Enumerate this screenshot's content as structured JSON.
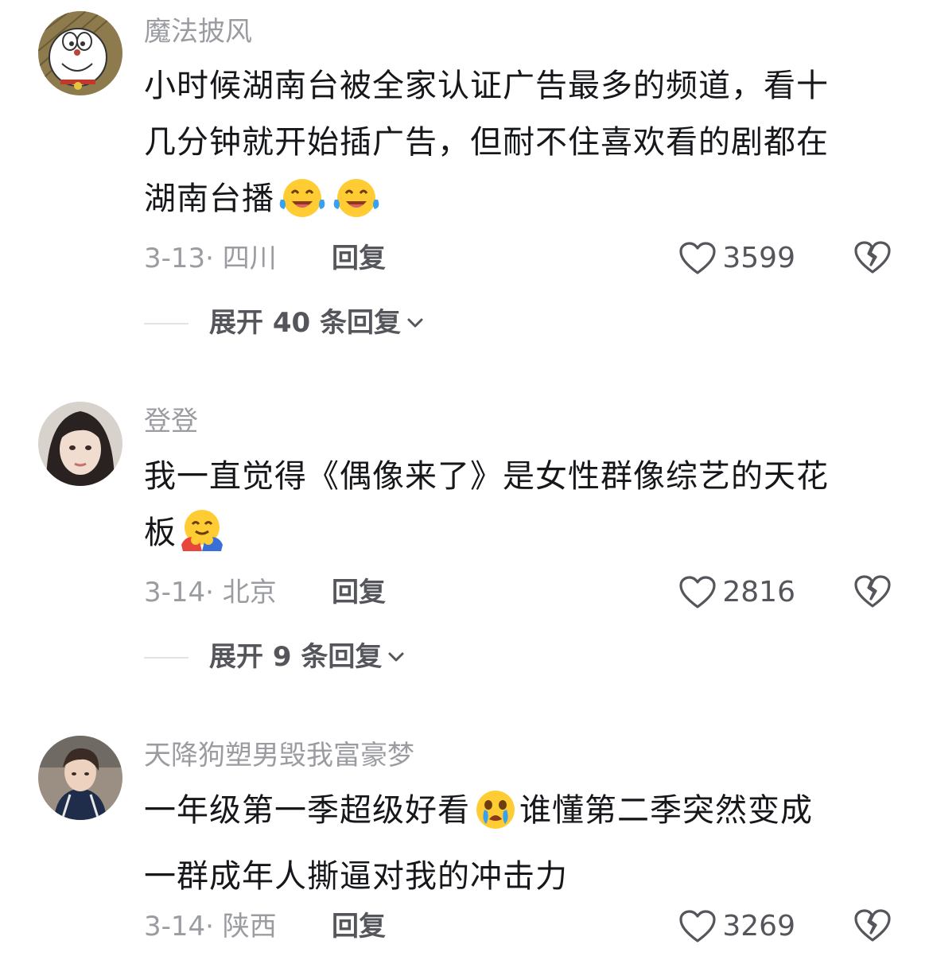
{
  "comments": [
    {
      "username": "魔法披风",
      "avatar_icon": "doraemon-avatar",
      "content_lines": [
        "小时候湖南台被全家认证广告最多的频道，看十",
        "几分钟就开始插广告，但耐不住喜欢看的剧都在",
        "湖南台播"
      ],
      "emojis": [
        "laughing-tears-emoji",
        "laughing-tears-emoji"
      ],
      "date_location": "3-13· 四川",
      "reply_label": "回复",
      "like_count": "3599",
      "expand_label": "展开 40 条回复"
    },
    {
      "username": "登登",
      "avatar_icon": "girl-photo-avatar",
      "content_lines": [
        "我一直觉得《偶像来了》是女性群像综艺的天花",
        "板"
      ],
      "emojis": [
        "hugging-face-emoji"
      ],
      "date_location": "3-14· 北京",
      "reply_label": "回复",
      "like_count": "2816",
      "expand_label": "展开 9 条回复"
    },
    {
      "username": "天降狗塑男毁我富豪梦",
      "avatar_icon": "boy-photo-avatar",
      "content_line1_before_emoji": "一年级第一季超级好看",
      "content_line1_after_emoji": "谁懂第二季突然变成",
      "content_line2": "一群成年人撕逼对我的冲击力",
      "emojis": [
        "crying-face-emoji"
      ],
      "date_location": "3-14· 陕西",
      "reply_label": "回复",
      "like_count": "3269"
    }
  ],
  "icons": {
    "like": "heart-outline-icon",
    "dislike": "broken-heart-icon",
    "expand": "chevron-down-icon"
  },
  "colors": {
    "username": "#9b9ca1",
    "content": "#16171b",
    "secondary": "#55565b",
    "emoji_yellow": "#ffcc33"
  }
}
